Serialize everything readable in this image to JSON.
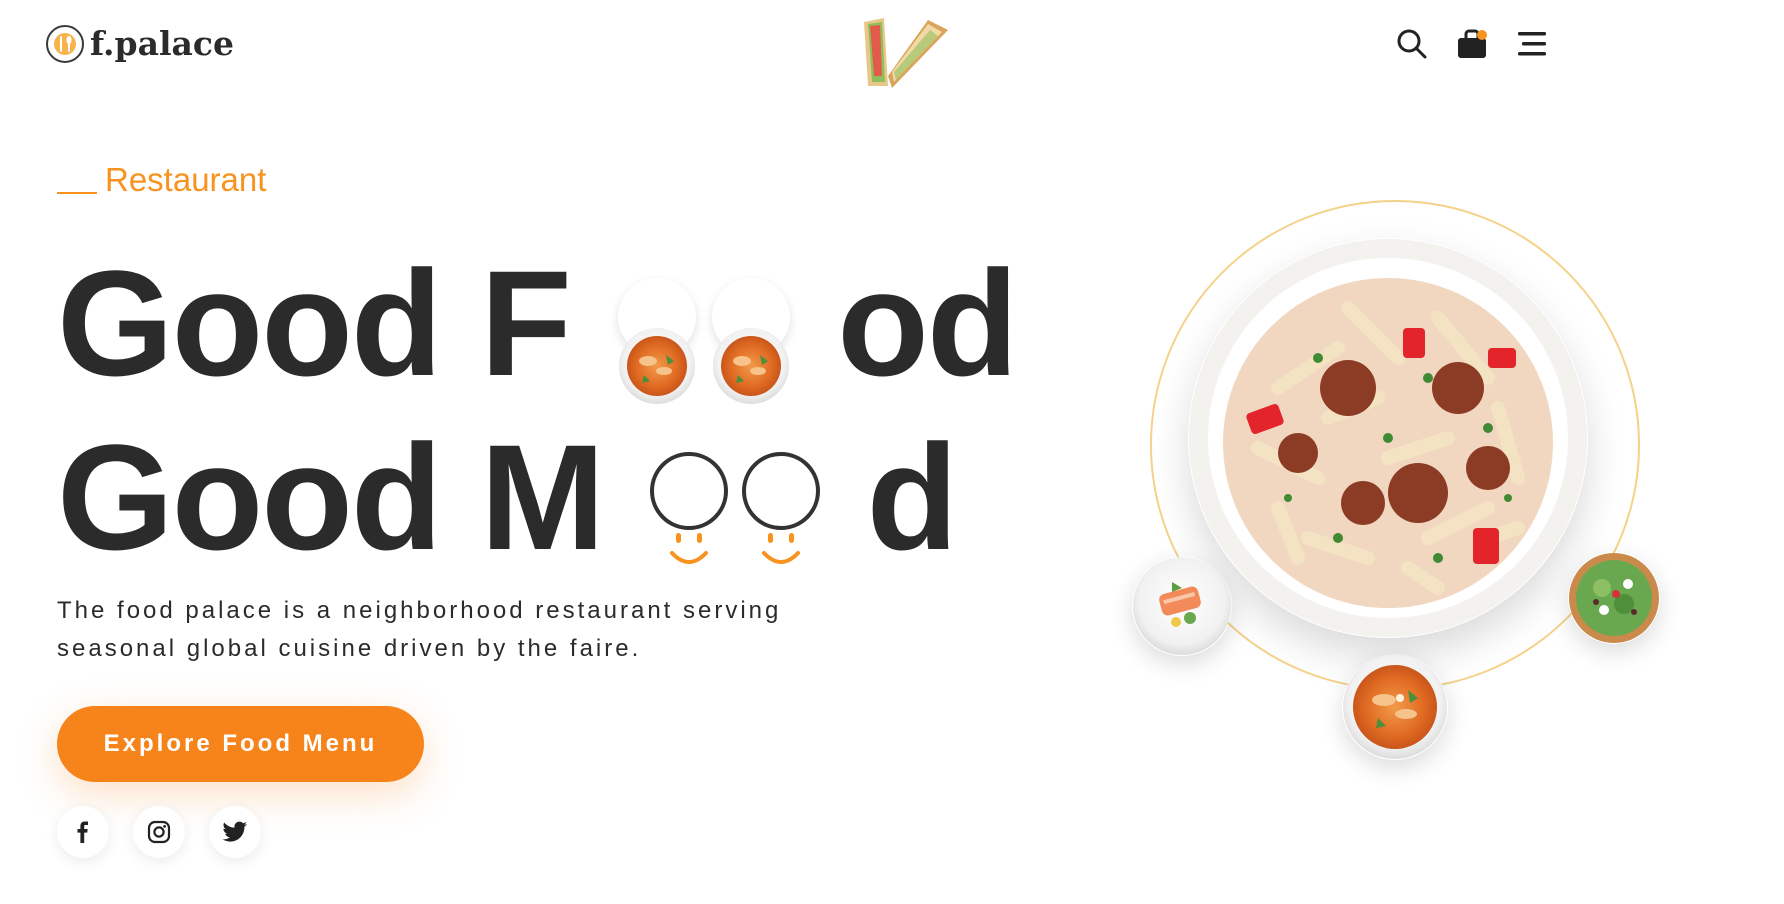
{
  "header": {
    "brand": "f.palace",
    "icons": [
      "search-icon",
      "cart-icon",
      "menu-icon"
    ],
    "cart_has_items": true
  },
  "hero": {
    "eyebrow": "Restaurant",
    "headline_line1": {
      "before": "Good F",
      "after": "od"
    },
    "headline_line2": {
      "before": "Good M",
      "after": "d"
    },
    "description": "The food palace is a neighborhood restaurant serving seasonal global cuisine driven by the faire.",
    "cta_label": "Explore Food Menu",
    "socials": [
      "facebook-icon",
      "instagram-icon",
      "twitter-icon"
    ]
  },
  "colors": {
    "accent": "#f7841a",
    "text": "#2b2b2b",
    "ring": "#f5d28a"
  }
}
